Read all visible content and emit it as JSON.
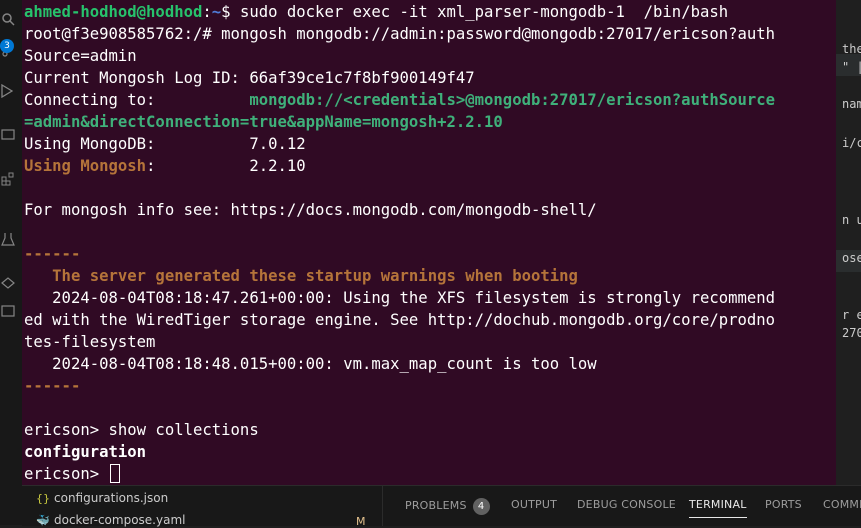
{
  "terminal": {
    "prompt_user": "ahmed-hodhod@hodhod",
    "prompt_sep": ":",
    "prompt_path": "~",
    "prompt_dollar": "$ ",
    "command1": "sudo docker exec -it xml_parser-mongodb-1  /bin/bash",
    "root_prompt": "root@f3e908585762:/# mongosh mongodb://admin:password@mongodb:27017/ericson?auth",
    "root_prompt_cont": "Source=admin",
    "log_id": "Current Mongosh Log ID: 66af39ce1c7f8bf900149f47",
    "connecting_label": "Connecting to:          ",
    "connecting_url": "mongodb://<credentials>@mongodb:27017/ericson?authSource",
    "connecting_url_cont": "=admin&directConnection=true&appName=mongosh+2.2.10",
    "mongodb_label": "Using MongoDB:          ",
    "mongodb_version": "7.0.12",
    "mongosh_label": "Using Mongosh",
    "mongosh_colon": ":",
    "mongosh_pad": "          ",
    "mongosh_version": "2.2.10",
    "info_line": "For mongosh info see: https://docs.mongodb.com/mongodb-shell/",
    "dashes": "------",
    "warning_title": "   The server generated these startup warnings when booting",
    "warning1": "   2024-08-04T08:18:47.261+00:00: Using the XFS filesystem is strongly recommend",
    "warning1_cont1": "ed with the WiredTiger storage engine. See http://dochub.mongodb.org/core/prodno",
    "warning1_cont2": "tes-filesystem",
    "warning2": "   2024-08-04T08:18:48.015+00:00: vm.max_map_count is too low",
    "dashes2": "------",
    "shell_command": "ericson> show collections",
    "collection": "configuration",
    "final_prompt": "ericson> "
  },
  "activity_bar": {
    "badge_count": "3",
    "icons": [
      "search-icon",
      "source-control-icon",
      "run-debug-icon",
      "remote-explorer-icon",
      "extensions-icon",
      "testing-icon",
      "docker-icon",
      "accounts-icon"
    ]
  },
  "editor_peek": {
    "fragments": [
      "the",
      "\" |",
      "nam",
      "i/c",
      "n us",
      "ose",
      "r e",
      "270"
    ]
  },
  "explorer": {
    "items": [
      {
        "icon": "json-braces-icon",
        "glyph": "{}",
        "name": "configurations.json"
      },
      {
        "icon": "docker-compose-icon",
        "glyph": "🐳",
        "name": "docker-compose.yaml",
        "status": "M"
      }
    ]
  },
  "panel": {
    "tabs": [
      "PROBLEMS",
      "OUTPUT",
      "DEBUG CONSOLE",
      "TERMINAL",
      "PORTS",
      "COMME"
    ],
    "problems_count": "4",
    "active_tab": "TERMINAL"
  },
  "colors": {
    "terminal_bg": "#300a24",
    "prompt_user": "#27c26c",
    "prompt_path": "#4f7bd6",
    "url_teal": "#3fb07a",
    "warning_orange": "#b5743a"
  }
}
